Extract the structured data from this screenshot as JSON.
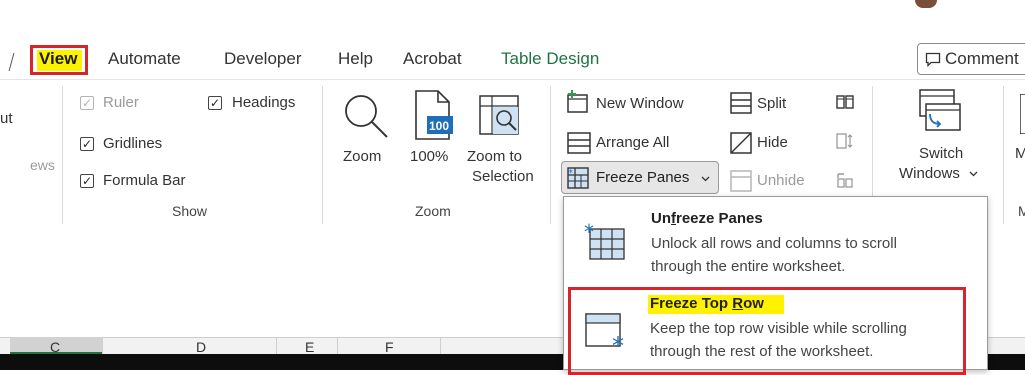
{
  "ribbon_tabs": {
    "view": "View",
    "automate": "Automate",
    "developer": "Developer",
    "help": "Help",
    "acrobat": "Acrobat",
    "table_design": "Table Design",
    "comments": "Comment"
  },
  "left_partial": {
    "frag1": "ut",
    "frag2": "ews"
  },
  "show_group": {
    "ruler": "Ruler",
    "gridlines": "Gridlines",
    "formula_bar": "Formula Bar",
    "headings": "Headings",
    "label": "Show"
  },
  "zoom_group": {
    "zoom": "Zoom",
    "hundred": "100%",
    "hundred_icon_text": "100",
    "zoom_to": "Zoom to",
    "selection": "Selection",
    "label": "Zoom"
  },
  "window_group": {
    "new_window": "New Window",
    "arrange_all": "Arrange All",
    "freeze_panes": "Freeze Panes",
    "split": "Split",
    "hide": "Hide",
    "unhide": "Unhide",
    "switch": "Switch",
    "windows": "Windows",
    "macros_partial": "M"
  },
  "freeze_menu": {
    "unfreeze_title_pre": "Un",
    "unfreeze_title_u": "f",
    "unfreeze_title_post": "reeze Panes",
    "unfreeze_desc1": "Unlock all rows and columns to scroll",
    "unfreeze_desc2": "through the entire worksheet.",
    "top_row_title_pre": "Freeze Top ",
    "top_row_title_u": "R",
    "top_row_title_post": "ow",
    "top_row_desc1": "Keep the top row visible while scrolling",
    "top_row_desc2": "through the rest of the worksheet."
  },
  "columns": [
    "C",
    "D",
    "E",
    "F"
  ],
  "colors": {
    "highlight": "#fff200",
    "callout_border": "#d6262b",
    "table_design": "#217346"
  }
}
